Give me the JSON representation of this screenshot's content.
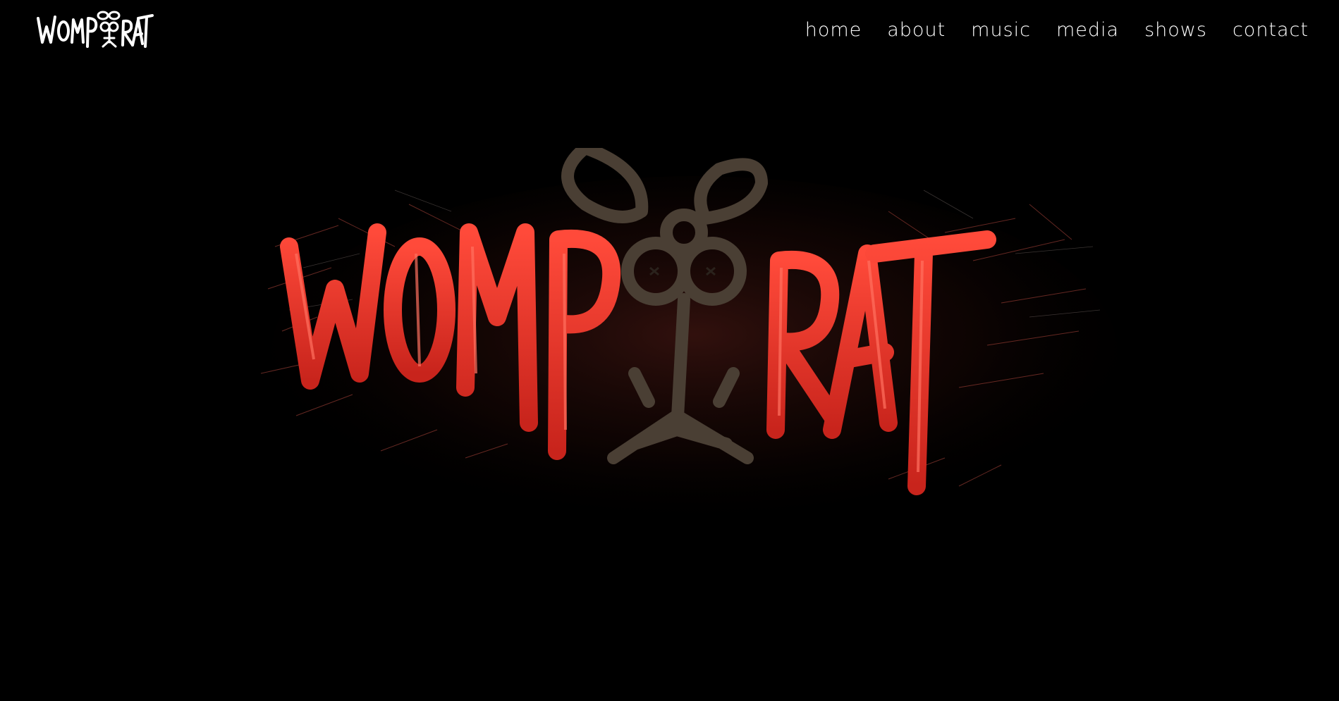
{
  "brand": {
    "logo_text": "WOMP RAT"
  },
  "nav": {
    "items": [
      {
        "label": "home"
      },
      {
        "label": "about"
      },
      {
        "label": "music"
      },
      {
        "label": "media"
      },
      {
        "label": "shows"
      },
      {
        "label": "contact"
      }
    ]
  },
  "hero": {
    "logo_text": "WOMP RAT"
  },
  "colors": {
    "background": "#000000",
    "nav_text": "#ffffff",
    "logo_red": "#e8392f",
    "rat_brown": "#4a3f34"
  }
}
